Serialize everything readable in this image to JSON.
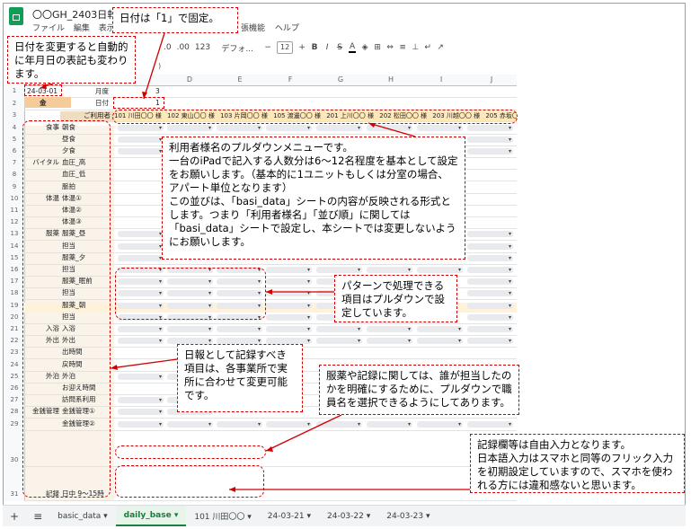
{
  "app": {
    "doc_title": "〇〇GH_2403日報",
    "menu": [
      "ファイル",
      "編集",
      "表示"
    ],
    "menu_tail": [
      "張機能",
      "ヘルプ"
    ]
  },
  "toolbar": {
    "percent_dec": ".0",
    "percent_inc": ".00",
    "number_format": "123",
    "font": "デフォ...",
    "minus": "−",
    "font_size": "12",
    "plus": "+",
    "bold": "B",
    "italic": "I",
    "strike": "S",
    "text_color": "A"
  },
  "formula_bar": {
    "paren": ")"
  },
  "grid": {
    "columns": [
      "D",
      "E",
      "F",
      "G",
      "H",
      "I",
      "J"
    ],
    "row_numbers": [
      "1",
      "2",
      "3",
      "4",
      "5",
      "6",
      "7",
      "8",
      "9",
      "10",
      "11",
      "12",
      "13",
      "14",
      "15",
      "16",
      "17",
      "18",
      "19",
      "20",
      "21",
      "22",
      "23",
      "24",
      "25",
      "26",
      "27",
      "28",
      "29",
      "30",
      "31",
      "32"
    ],
    "a1": "24-03-01",
    "a2": "金",
    "month_label": "月度",
    "month_value": "3",
    "day_label": "日付",
    "day_value": "1",
    "users_label": "ご利用者",
    "users": [
      "101 川田〇〇 様",
      "102 東山〇〇 様",
      "103 片岡〇〇 様",
      "105 渡邊〇〇 様",
      "201 上川〇〇 様",
      "202 松田〇〇 様",
      "203 川越〇〇 様",
      "205 赤坂〇〇 様"
    ],
    "row_labels": [
      {
        "cat": "食事",
        "item": "朝食"
      },
      {
        "cat": "",
        "item": "昼食"
      },
      {
        "cat": "",
        "item": "夕食"
      },
      {
        "cat": "バイタル",
        "item": "血圧_高"
      },
      {
        "cat": "",
        "item": "血圧_低"
      },
      {
        "cat": "",
        "item": "脈拍"
      },
      {
        "cat": "体温",
        "item": "体温①"
      },
      {
        "cat": "",
        "item": "体温②"
      },
      {
        "cat": "",
        "item": "体温③"
      },
      {
        "cat": "服薬",
        "item": "服薬_昼"
      },
      {
        "cat": "",
        "item": "担当"
      },
      {
        "cat": "",
        "item": "服薬_夕"
      },
      {
        "cat": "",
        "item": "担当"
      },
      {
        "cat": "",
        "item": "服薬_眠前"
      },
      {
        "cat": "",
        "item": "担当"
      },
      {
        "cat": "",
        "item": "服薬_朝"
      },
      {
        "cat": "",
        "item": "担当"
      },
      {
        "cat": "入浴",
        "item": "入浴"
      },
      {
        "cat": "外出",
        "item": "外出"
      },
      {
        "cat": "",
        "item": "出時間"
      },
      {
        "cat": "",
        "item": "戻時間"
      },
      {
        "cat": "外泊",
        "item": "外泊"
      },
      {
        "cat": "",
        "item": "お迎え時間"
      },
      {
        "cat": "",
        "item": "訪問系利用"
      },
      {
        "cat": "金銭管理",
        "item": "金銭管理①"
      },
      {
        "cat": "",
        "item": "金銭管理②"
      },
      {
        "cat": "",
        "item": ""
      },
      {
        "cat": "記録",
        "item": "日中 9～15時"
      },
      {
        "cat": "",
        "item": "記入者①"
      },
      {
        "cat": "",
        "item": ""
      }
    ]
  },
  "callouts": {
    "date_fixed": "日付は「1」で固定。",
    "date_change": "日付を変更すると自動的に年月日の表記も変わります。",
    "pulldown_users": "利用者様名のプルダウンメニューです。\n一台のiPadで記入する人数分は6～12名程度を基本として設定をお願いします。（基本的に1ユニットもしくは分室の場合、アパート単位となります）\nこの並びは、「basi_data」シートの内容が反映される形式とします。つまり「利用者様名」「並び順」に関しては「basi_data」シートで設定し、本シートでは変更しないようにお願いします。",
    "pattern": "パターンで処理できる項目はプルダウンで設定しています。",
    "items": "日報として記録すべき項目は、各事業所で実所に合わせて変更可能です。",
    "staff": "服薬や記録に関しては、誰が担当したのかを明確にするために、プルダウンで職員名を選択できるようにしてあります。",
    "free_input": "記録欄等は自由入力となります。\n日本語入力はスマホと同等のフリック入力を初期設定していますので、スマホを使われる方には違和感ないと思います。"
  },
  "tabs": {
    "add": "+",
    "menu": "≡",
    "items": [
      "basic_data ▾",
      "daily_base ▾",
      "101 川田〇〇 ▾",
      "24-03-21 ▾",
      "24-03-22 ▾",
      "24-03-23 ▾"
    ],
    "active_index": 1
  },
  "colors": {
    "callout_border": "#d10000",
    "sheets_green": "#0f9d58",
    "user_row": "#ffe8b8",
    "label_tan": "#f0dcc0"
  }
}
